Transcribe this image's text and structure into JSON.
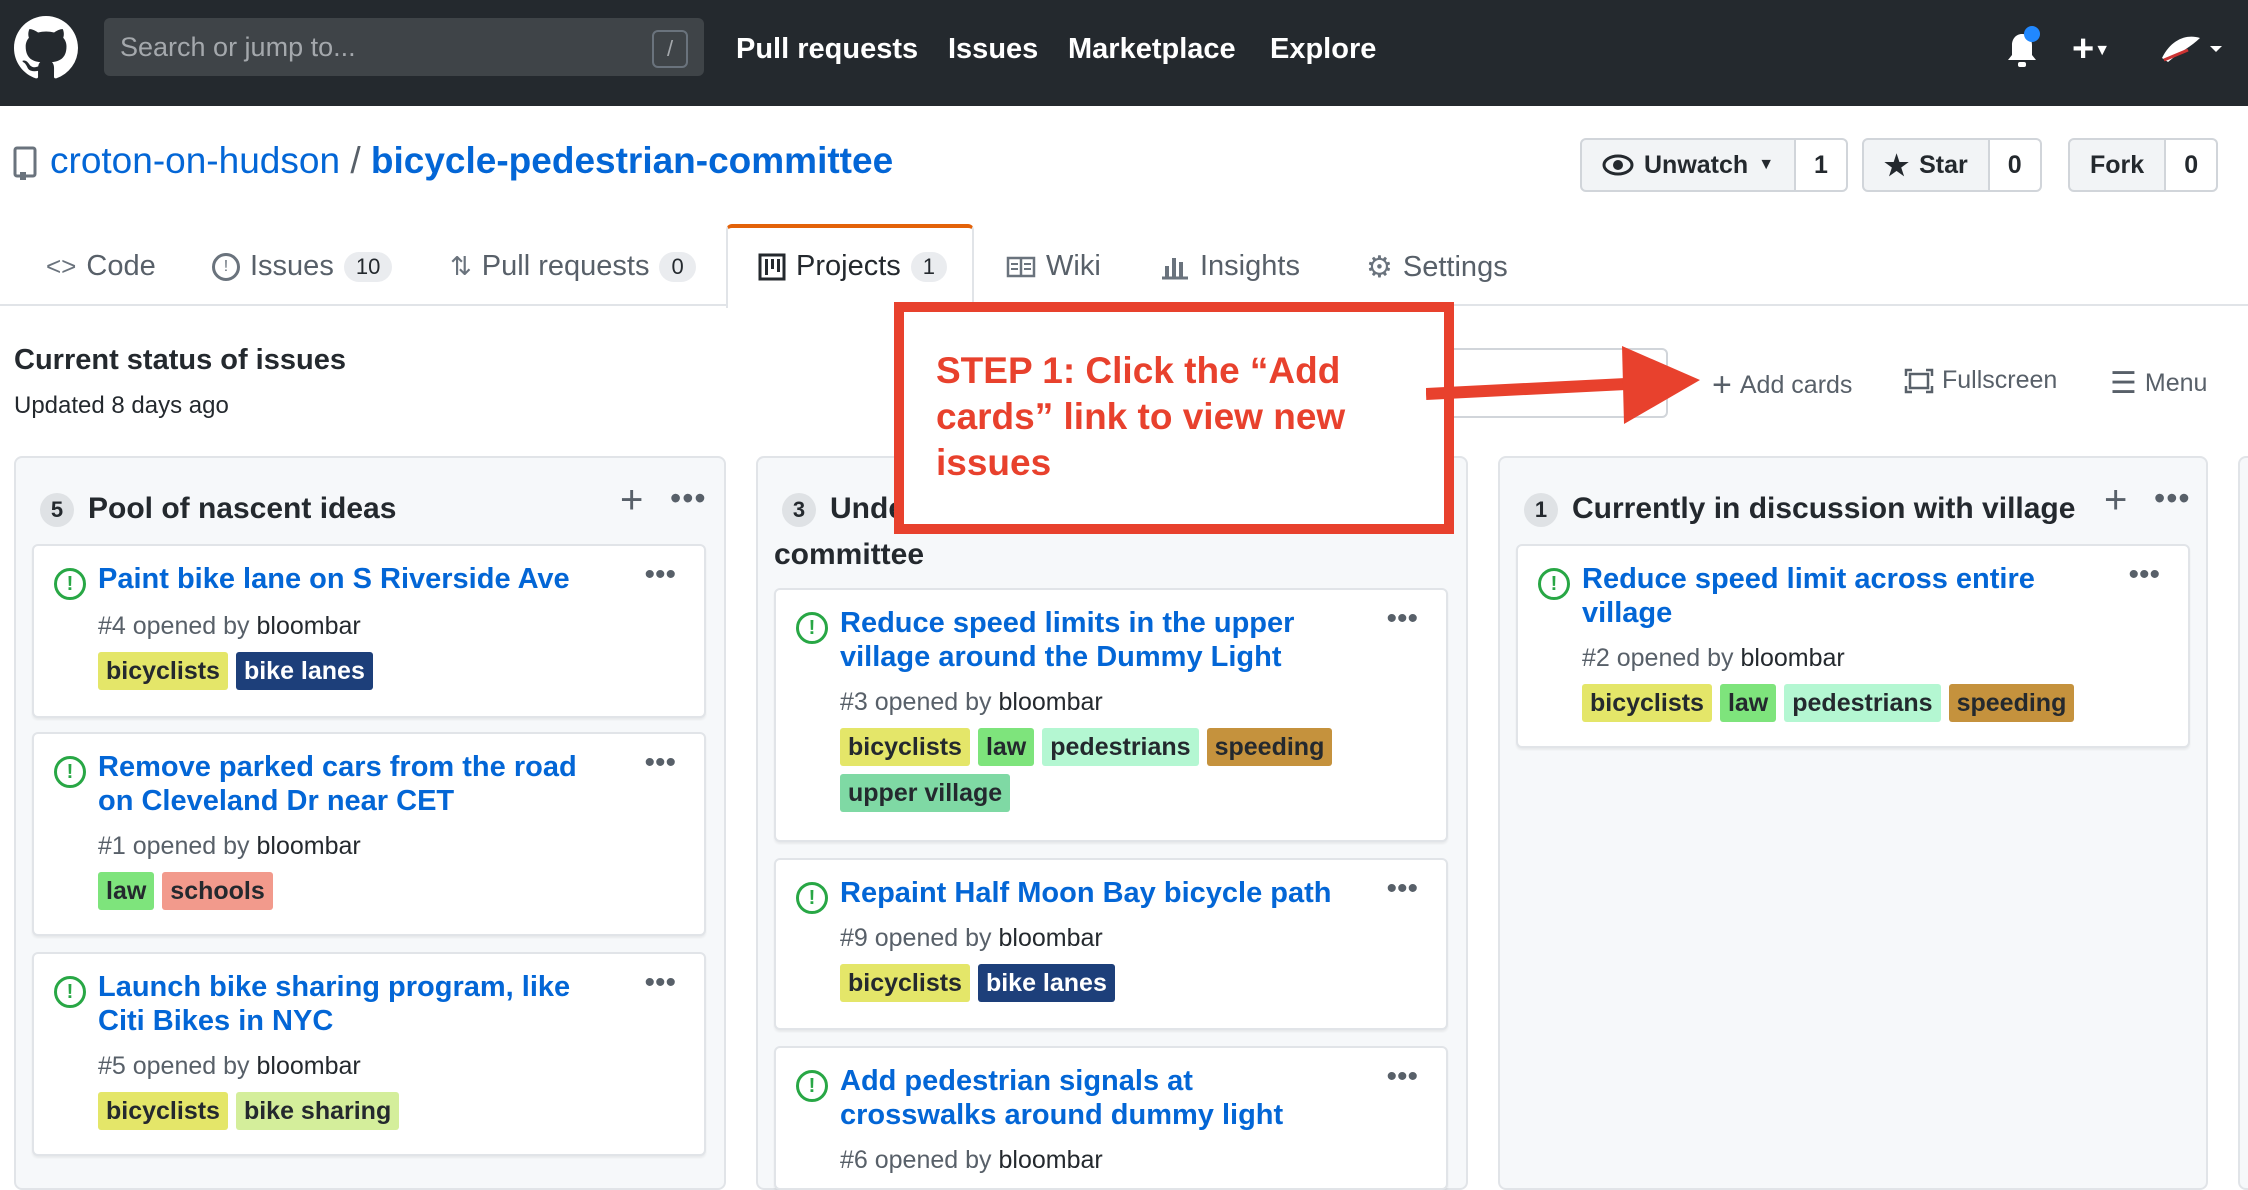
{
  "header": {
    "search_placeholder": "Search or jump to...",
    "search_shortcut": "/",
    "nav": [
      "Pull requests",
      "Issues",
      "Marketplace",
      "Explore"
    ]
  },
  "repo": {
    "owner": "croton-on-hudson",
    "separator": "/",
    "name": "bicycle-pedestrian-committee",
    "unwatch_label": "Unwatch",
    "watch_count": "1",
    "star_label": "Star",
    "star_count": "0",
    "fork_label": "Fork",
    "fork_count": "0"
  },
  "tabs": [
    {
      "label": "Code",
      "count": ""
    },
    {
      "label": "Issues",
      "count": "10"
    },
    {
      "label": "Pull requests",
      "count": "0"
    },
    {
      "label": "Projects",
      "count": "1"
    },
    {
      "label": "Wiki",
      "count": ""
    },
    {
      "label": "Insights",
      "count": ""
    },
    {
      "label": "Settings",
      "count": ""
    }
  ],
  "project": {
    "name": "Current status of issues",
    "updated": "Updated 8 days ago",
    "add_cards": "Add cards",
    "fullscreen": "Fullscreen",
    "menu": "Menu"
  },
  "annotation": {
    "text": "STEP 1: Click the “Add cards” link to view new issues"
  },
  "columns": [
    {
      "count": "5",
      "title": "Pool of nascent ideas",
      "cards": [
        {
          "title": "Paint bike lane on S Riverside Ave",
          "number": "#4 opened by",
          "author": "bloombar",
          "labels": [
            "bicyclists",
            "bike lanes"
          ]
        },
        {
          "title": "Remove parked cars from the road on Cleveland Dr near CET",
          "number": "#1 opened by",
          "author": "bloombar",
          "labels": [
            "law",
            "schools"
          ]
        },
        {
          "title": "Launch bike sharing program, like Citi Bikes in NYC",
          "number": "#5 opened by",
          "author": "bloombar",
          "labels": [
            "bicyclists",
            "bike sharing"
          ]
        }
      ]
    },
    {
      "count": "3",
      "title": "Unde",
      "title_line2": "committee",
      "cards": [
        {
          "title": "Reduce speed limits in the upper village around the Dummy Light",
          "number": "#3 opened by",
          "author": "bloombar",
          "labels": [
            "bicyclists",
            "law",
            "pedestrians",
            "speeding",
            "upper village"
          ]
        },
        {
          "title": "Repaint Half Moon Bay bicycle path",
          "number": "#9 opened by",
          "author": "bloombar",
          "labels": [
            "bicyclists",
            "bike lanes"
          ]
        },
        {
          "title": "Add pedestrian signals at crosswalks around dummy light",
          "number": "#6 opened by",
          "author": "bloombar",
          "labels": []
        }
      ]
    },
    {
      "count": "1",
      "title": "Currently in discussion with village",
      "cards": [
        {
          "title": "Reduce speed limit across entire village",
          "number": "#2 opened by",
          "author": "bloombar",
          "labels": [
            "bicyclists",
            "law",
            "pedestrians",
            "speeding"
          ]
        }
      ]
    }
  ],
  "label_colors": {
    "bicyclists": {
      "bg": "#e4e669",
      "fg": "#24292e"
    },
    "bike lanes": {
      "bg": "#1d3f7a",
      "fg": "#ffffff"
    },
    "law": {
      "bg": "#7ee47c",
      "fg": "#24292e"
    },
    "schools": {
      "bg": "#f29a8c",
      "fg": "#24292e"
    },
    "bike sharing": {
      "bg": "#d4ee9b",
      "fg": "#24292e"
    },
    "pedestrians": {
      "bg": "#b4f7d2",
      "fg": "#24292e"
    },
    "speeding": {
      "bg": "#c5923d",
      "fg": "#24292e"
    },
    "upper village": {
      "bg": "#7fd9a4",
      "fg": "#24292e"
    }
  }
}
